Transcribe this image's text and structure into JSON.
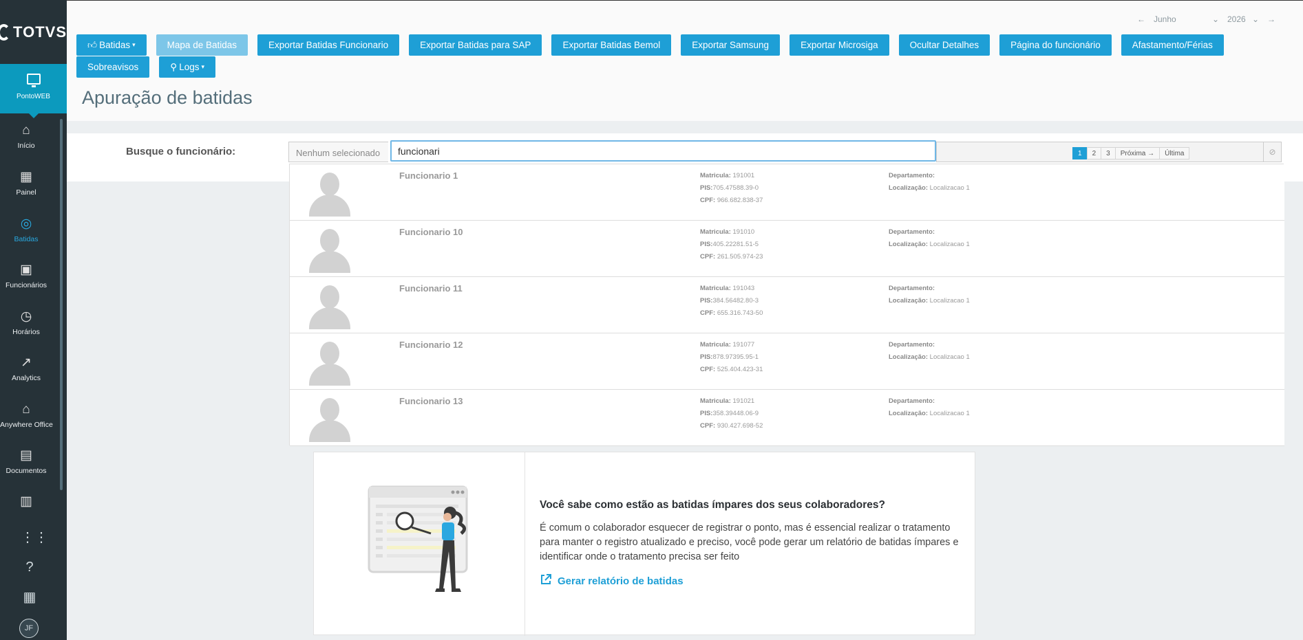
{
  "brand": {
    "logo_text": "TOTVS"
  },
  "sidebar": {
    "active_app": "PontoWEB",
    "items": [
      {
        "label": "Início",
        "icon": "home-icon"
      },
      {
        "label": "Painel",
        "icon": "dashboard-icon"
      },
      {
        "label": "Batidas",
        "icon": "fingerprint-icon"
      },
      {
        "label": "Funcionários",
        "icon": "badge-icon"
      },
      {
        "label": "Horários",
        "icon": "clock-icon"
      },
      {
        "label": "Analytics",
        "icon": "trending-up-icon"
      },
      {
        "label": "Anywhere Office",
        "icon": "home-work-icon"
      },
      {
        "label": "Documentos",
        "icon": "document-icon"
      }
    ],
    "active_item": "Batidas",
    "avatar_initials": "JF"
  },
  "period": {
    "month": "Junho",
    "year": "2026"
  },
  "toolbar": {
    "buttons": [
      "Batidas",
      "Mapa de Batidas",
      "Exportar Batidas Funcionario",
      "Exportar Batidas para SAP",
      "Exportar Batidas Bemol",
      "Exportar Samsung",
      "Exportar Microsiga",
      "Ocultar Detalhes",
      "Página do funcionário",
      "Afastamento/Férias",
      "Sobreavisos",
      "Logs"
    ]
  },
  "page_title": "Apuração de batidas",
  "search": {
    "label": "Busque o funcionário:",
    "selected_text": "Nenhum selecionado",
    "value": "funcionari",
    "pager": [
      "1",
      "2",
      "3",
      "Próxima →",
      "Última"
    ]
  },
  "labels": {
    "matricula": "Matricula:",
    "pis": "PIS:",
    "cpf": "CPF:",
    "departamento": "Departamento:",
    "localizacao": "Localização:"
  },
  "employees": [
    {
      "name": "Funcionario 1",
      "matricula": "191001",
      "pis": "705.47588.39-0",
      "cpf": "966.682.838-37",
      "departamento": "",
      "localizacao": "Localizacao 1"
    },
    {
      "name": "Funcionario 10",
      "matricula": "191010",
      "pis": "405.22281.51-5",
      "cpf": "261.505.974-23",
      "departamento": "",
      "localizacao": "Localizacao 1"
    },
    {
      "name": "Funcionario 11",
      "matricula": "191043",
      "pis": "384.56482.80-3",
      "cpf": "655.316.743-50",
      "departamento": "",
      "localizacao": "Localizacao 1"
    },
    {
      "name": "Funcionario 12",
      "matricula": "191077",
      "pis": "878.97395.95-1",
      "cpf": "525.404.423-31",
      "departamento": "",
      "localizacao": "Localizacao 1"
    },
    {
      "name": "Funcionario 13",
      "matricula": "191021",
      "pis": "358.39448.06-9",
      "cpf": "930.427.698-52",
      "departamento": "",
      "localizacao": "Localizacao 1"
    }
  ],
  "card": {
    "title": "Você sabe como estão as batidas ímpares dos seus colaboradores?",
    "text": "É comum o colaborador esquecer de registrar o ponto, mas é essencial realizar o tratamento para manter o registro atualizado e preciso, você pode gerar um relatório de batidas ímpares e identificar onde o tratamento precisa ser feito",
    "link": "Gerar relatório de batidas"
  },
  "colors": {
    "accent": "#1e9fd6",
    "sidebar": "#263238",
    "active_app": "#0c9abe"
  }
}
